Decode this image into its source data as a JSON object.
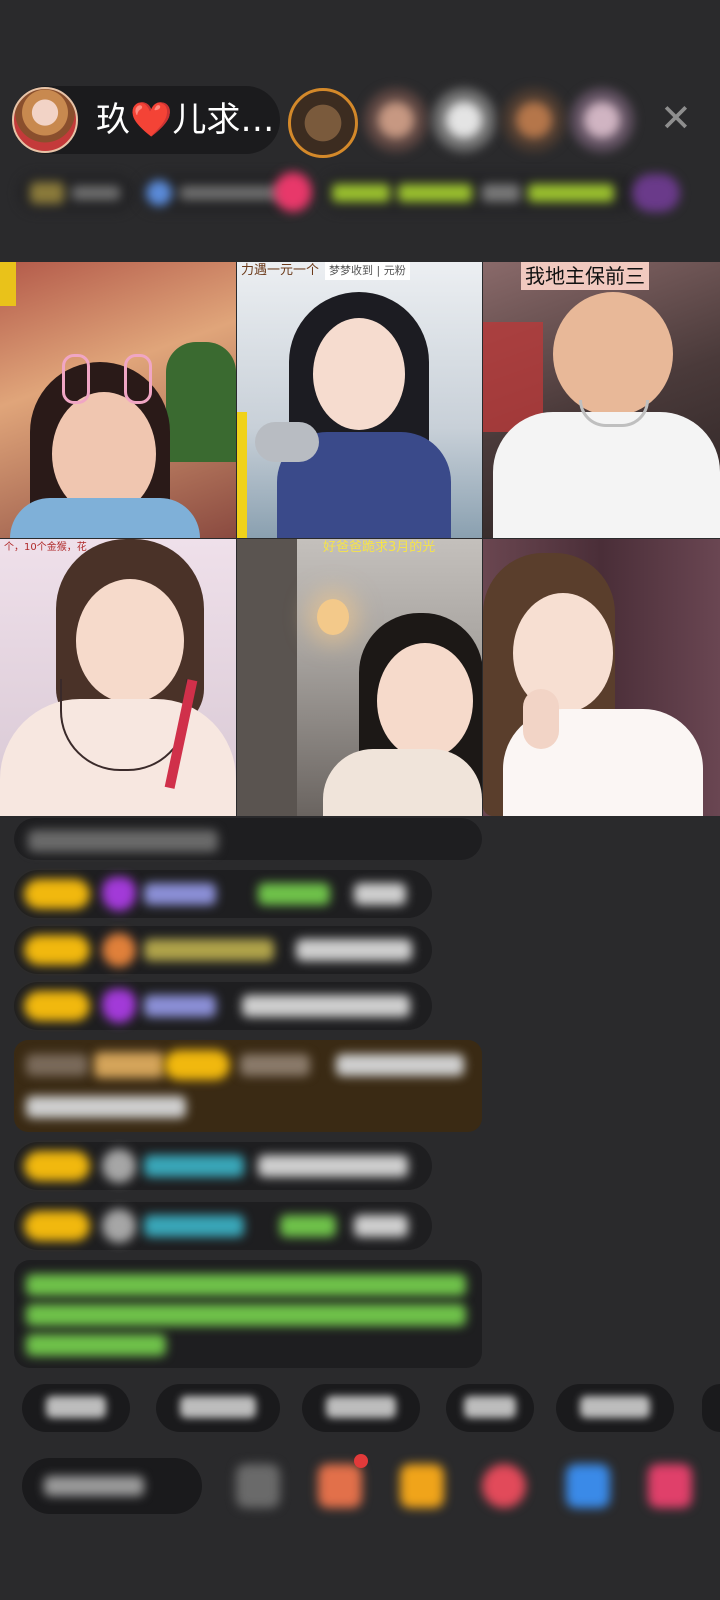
{
  "host": {
    "name": "玖❤️儿求…",
    "avatar_icon": "host-avatar-icon"
  },
  "header": {
    "close_icon": "close-icon",
    "audience_avatars": [
      "audience-avatar-1",
      "audience-avatar-2",
      "audience-avatar-3",
      "audience-avatar-4",
      "audience-avatar-5"
    ]
  },
  "grid": {
    "tiles": [
      {
        "label": ""
      },
      {
        "label": "梦梦收到 | 元粉",
        "sublabel": "力遇一元一个"
      },
      {
        "label": "我地主保前三"
      },
      {
        "label": "个，10个金猴，花"
      },
      {
        "label": "好爸爸跪求3月的光"
      },
      {
        "label": ""
      }
    ]
  },
  "colors": {
    "background": "#2a2a2c",
    "badge": "#f1b80e",
    "chat_green": "#6fc24a",
    "chat_cyan": "#39a6b8",
    "highlight_bg": "#3a2a14"
  }
}
